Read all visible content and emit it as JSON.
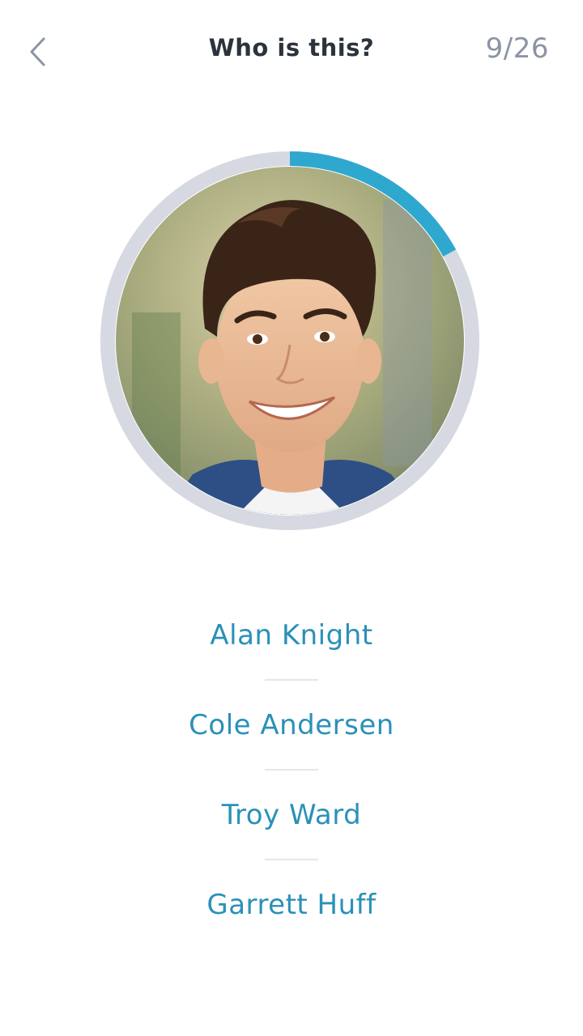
{
  "header": {
    "title": "Who is this?",
    "progress_text": "9/26",
    "back_icon": "chevron-left-icon"
  },
  "quiz": {
    "current": 9,
    "total": 26,
    "timer_fraction": 0.17,
    "colors": {
      "timer": "#2fa8d0",
      "ring_track": "#d6d9e1",
      "option_text": "#2a91b8",
      "title_text": "#2c333c",
      "counter_text": "#8c94a3"
    }
  },
  "options": [
    {
      "label": "Alan Knight"
    },
    {
      "label": "Cole Andersen"
    },
    {
      "label": "Troy Ward"
    },
    {
      "label": "Garrett Huff"
    }
  ]
}
